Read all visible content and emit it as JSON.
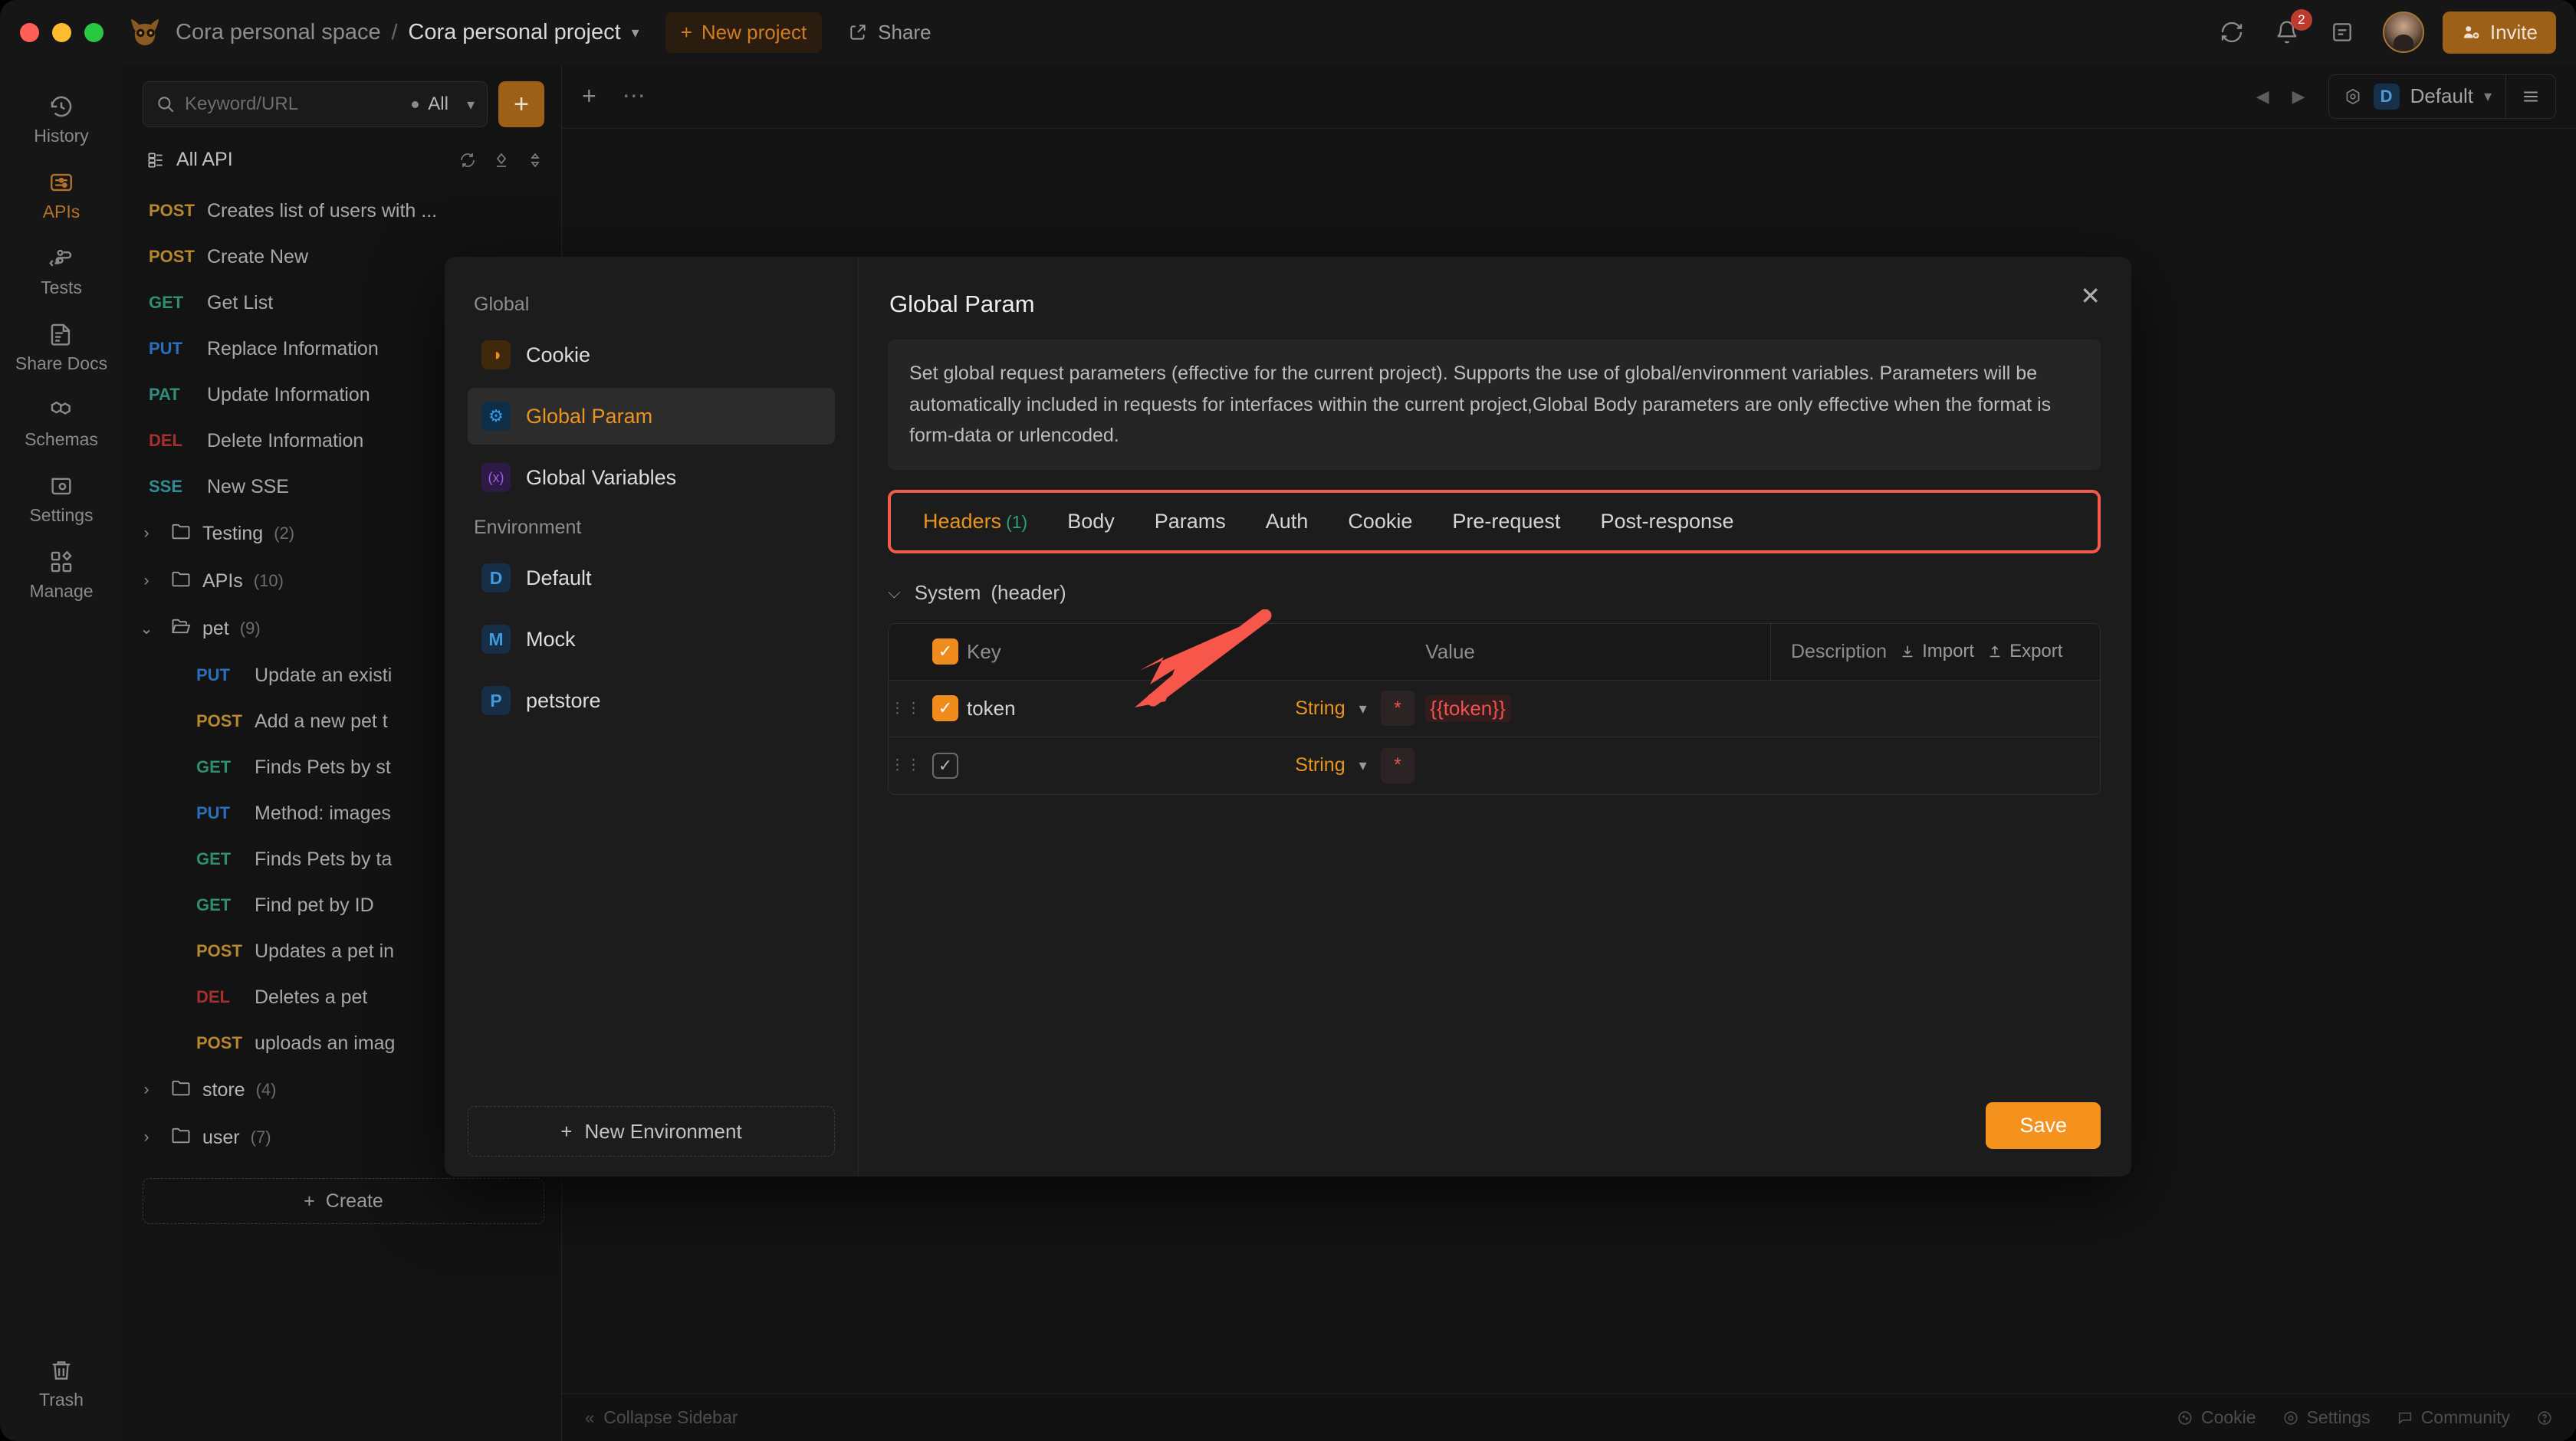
{
  "titlebar": {
    "space": "Cora personal space",
    "separator": "/",
    "project": "Cora personal project",
    "new_project": "New project",
    "share": "Share",
    "notification_count": "2",
    "invite": "Invite"
  },
  "rail": {
    "items": [
      {
        "label": "History",
        "icon": "history-icon",
        "active": false
      },
      {
        "label": "APIs",
        "icon": "apis-icon",
        "active": true
      },
      {
        "label": "Tests",
        "icon": "tests-icon",
        "active": false
      },
      {
        "label": "Share Docs",
        "icon": "share-docs-icon",
        "active": false
      },
      {
        "label": "Schemas",
        "icon": "schemas-icon",
        "active": false
      },
      {
        "label": "Settings",
        "icon": "settings-icon",
        "active": false
      },
      {
        "label": "Manage",
        "icon": "manage-icon",
        "active": false
      }
    ],
    "trash": "Trash"
  },
  "sidebar": {
    "search_placeholder": "Keyword/URL",
    "filter_label": "All",
    "add_button": "+",
    "all_api": "All API",
    "create_label": "Create",
    "items": [
      {
        "kind": "api",
        "method": "POST",
        "method_class": "post",
        "label": "Creates list of users with ...",
        "indent": false
      },
      {
        "kind": "api",
        "method": "POST",
        "method_class": "post",
        "label": "Create New",
        "indent": false
      },
      {
        "kind": "api",
        "method": "GET",
        "method_class": "get",
        "label": "Get List",
        "indent": false
      },
      {
        "kind": "api",
        "method": "PUT",
        "method_class": "put",
        "label": "Replace Information",
        "indent": false
      },
      {
        "kind": "api",
        "method": "PAT",
        "method_class": "pat",
        "label": "Update Information",
        "indent": false
      },
      {
        "kind": "api",
        "method": "DEL",
        "method_class": "del",
        "label": "Delete Information",
        "indent": false
      },
      {
        "kind": "api",
        "method": "SSE",
        "method_class": "sse",
        "label": "New SSE",
        "indent": false
      },
      {
        "kind": "folder",
        "chevron": "›",
        "label": "Testing",
        "count": "(2)",
        "open": false
      },
      {
        "kind": "folder",
        "chevron": "›",
        "label": "APIs",
        "count": "(10)",
        "open": false
      },
      {
        "kind": "folder",
        "chevron": "⌄",
        "label": "pet",
        "count": "(9)",
        "open": true
      },
      {
        "kind": "api",
        "method": "PUT",
        "method_class": "put",
        "label": "Update an existi",
        "indent": true
      },
      {
        "kind": "api",
        "method": "POST",
        "method_class": "post",
        "label": "Add a new pet t",
        "indent": true
      },
      {
        "kind": "api",
        "method": "GET",
        "method_class": "get",
        "label": "Finds Pets by st",
        "indent": true
      },
      {
        "kind": "api",
        "method": "PUT",
        "method_class": "put",
        "label": "Method: images",
        "indent": true
      },
      {
        "kind": "api",
        "method": "GET",
        "method_class": "get",
        "label": "Finds Pets by ta",
        "indent": true
      },
      {
        "kind": "api",
        "method": "GET",
        "method_class": "get",
        "label": "Find pet by ID",
        "indent": true
      },
      {
        "kind": "api",
        "method": "POST",
        "method_class": "post",
        "label": "Updates a pet in",
        "indent": true
      },
      {
        "kind": "api",
        "method": "DEL",
        "method_class": "del",
        "label": "Deletes a pet",
        "indent": true
      },
      {
        "kind": "api",
        "method": "POST",
        "method_class": "post",
        "label": "uploads an imag",
        "indent": true
      },
      {
        "kind": "folder",
        "chevron": "›",
        "label": "store",
        "count": "(4)",
        "open": false
      },
      {
        "kind": "folder",
        "chevron": "›",
        "label": "user",
        "count": "(7)",
        "open": false
      }
    ]
  },
  "main": {
    "env_badge": "D",
    "env_name": "Default"
  },
  "statusbar": {
    "collapse": "Collapse Sidebar",
    "cookie": "Cookie",
    "settings": "Settings",
    "community": "Community"
  },
  "modal": {
    "title": "Global Param",
    "close": "✕",
    "description": "Set global request parameters (effective for the current project). Supports the use of global/environment variables. Parameters will be automatically included in requests for interfaces within the current project,Global Body parameters are only effective when the format is form-data or urlencoded.",
    "groups": [
      {
        "label": "Global",
        "items": [
          {
            "label": "Cookie",
            "icon": "cookie-icon",
            "icon_class": "ic-cookie",
            "glyph": "◑",
            "active": false
          },
          {
            "label": "Global Param",
            "icon": "global-param-icon",
            "icon_class": "ic-param",
            "glyph": "⚙",
            "active": true
          },
          {
            "label": "Global Variables",
            "icon": "global-variables-icon",
            "icon_class": "ic-var",
            "glyph": "(x)",
            "active": false
          }
        ]
      },
      {
        "label": "Environment",
        "items": [
          {
            "label": "Default",
            "icon": "env-default-icon",
            "icon_class": "ic-env",
            "glyph": "D",
            "active": false
          },
          {
            "label": "Mock",
            "icon": "env-mock-icon",
            "icon_class": "ic-env",
            "glyph": "M",
            "active": false
          },
          {
            "label": "petstore",
            "icon": "env-petstore-icon",
            "icon_class": "ic-env",
            "glyph": "P",
            "active": false
          }
        ]
      }
    ],
    "new_environment": "New Environment",
    "tabs": [
      {
        "label": "Headers",
        "count": "(1)",
        "active": true
      },
      {
        "label": "Body",
        "count": "",
        "active": false
      },
      {
        "label": "Params",
        "count": "",
        "active": false
      },
      {
        "label": "Auth",
        "count": "",
        "active": false
      },
      {
        "label": "Cookie",
        "count": "",
        "active": false
      },
      {
        "label": "Pre-request",
        "count": "",
        "active": false
      },
      {
        "label": "Post-response",
        "count": "",
        "active": false
      }
    ],
    "system_header": "System (header)",
    "table": {
      "headers": {
        "key": "Key",
        "value": "Value",
        "description": "Description",
        "import": "Import",
        "export": "Export"
      },
      "rows": [
        {
          "checked": true,
          "key": "token",
          "type": "String",
          "required": "*",
          "value": "{{token}}",
          "description": ""
        },
        {
          "checked": true,
          "key": "",
          "type": "String",
          "required": "*",
          "value": "",
          "description": ""
        }
      ]
    },
    "save": "Save"
  }
}
